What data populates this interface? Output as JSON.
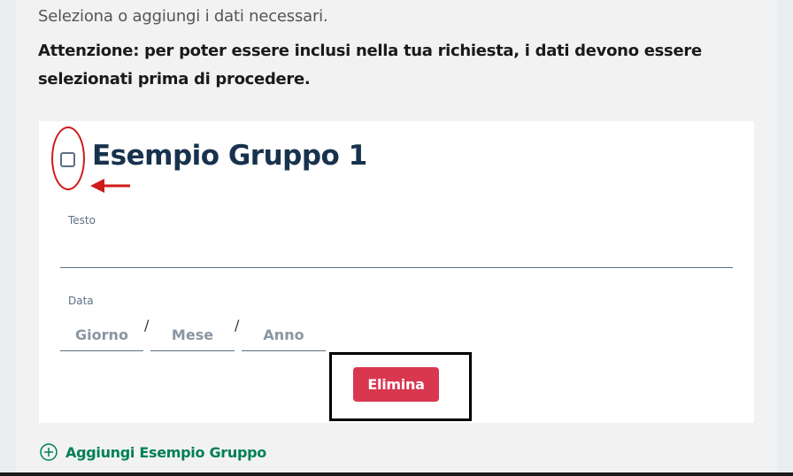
{
  "intro_text": "Seleziona o aggiungi i dati necessari.",
  "warning_text": "Attenzione: per poter essere inclusi nella tua richiesta, i dati devono essere selezionati prima di procedere.",
  "group": {
    "title": "Esempio Gruppo 1",
    "checkbox_checked": false,
    "text_field": {
      "label": "Testo",
      "value": ""
    },
    "date_field": {
      "label": "Data",
      "day_placeholder": "Giorno",
      "month_placeholder": "Mese",
      "year_placeholder": "Anno",
      "separator": "/"
    },
    "delete_label": "Elimina"
  },
  "add_label": "Aggiungi Esempio Gruppo",
  "colors": {
    "title": "#17324d",
    "delete_button": "#d9364f",
    "add_link": "#008055",
    "annotation": "#d11a1a"
  },
  "icons": {
    "add": "plus-circle-icon",
    "annotation_arrow": "left-arrow-icon"
  }
}
